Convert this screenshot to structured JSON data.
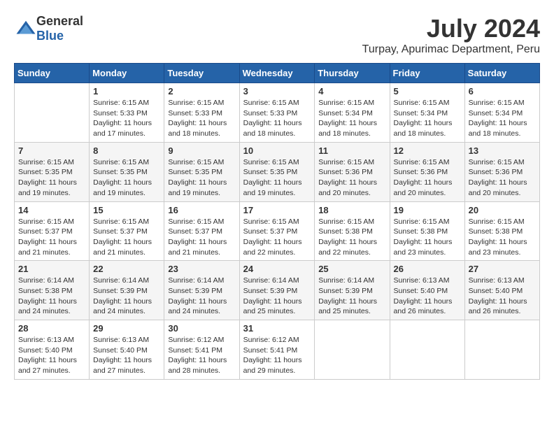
{
  "header": {
    "logo_general": "General",
    "logo_blue": "Blue",
    "month_title": "July 2024",
    "location": "Turpay, Apurimac Department, Peru"
  },
  "weekdays": [
    "Sunday",
    "Monday",
    "Tuesday",
    "Wednesday",
    "Thursday",
    "Friday",
    "Saturday"
  ],
  "weeks": [
    [
      {
        "day": "",
        "sunrise": "",
        "sunset": "",
        "daylight": ""
      },
      {
        "day": "1",
        "sunrise": "Sunrise: 6:15 AM",
        "sunset": "Sunset: 5:33 PM",
        "daylight": "Daylight: 11 hours and 17 minutes."
      },
      {
        "day": "2",
        "sunrise": "Sunrise: 6:15 AM",
        "sunset": "Sunset: 5:33 PM",
        "daylight": "Daylight: 11 hours and 18 minutes."
      },
      {
        "day": "3",
        "sunrise": "Sunrise: 6:15 AM",
        "sunset": "Sunset: 5:33 PM",
        "daylight": "Daylight: 11 hours and 18 minutes."
      },
      {
        "day": "4",
        "sunrise": "Sunrise: 6:15 AM",
        "sunset": "Sunset: 5:34 PM",
        "daylight": "Daylight: 11 hours and 18 minutes."
      },
      {
        "day": "5",
        "sunrise": "Sunrise: 6:15 AM",
        "sunset": "Sunset: 5:34 PM",
        "daylight": "Daylight: 11 hours and 18 minutes."
      },
      {
        "day": "6",
        "sunrise": "Sunrise: 6:15 AM",
        "sunset": "Sunset: 5:34 PM",
        "daylight": "Daylight: 11 hours and 18 minutes."
      }
    ],
    [
      {
        "day": "7",
        "sunrise": "Sunrise: 6:15 AM",
        "sunset": "Sunset: 5:35 PM",
        "daylight": "Daylight: 11 hours and 19 minutes."
      },
      {
        "day": "8",
        "sunrise": "Sunrise: 6:15 AM",
        "sunset": "Sunset: 5:35 PM",
        "daylight": "Daylight: 11 hours and 19 minutes."
      },
      {
        "day": "9",
        "sunrise": "Sunrise: 6:15 AM",
        "sunset": "Sunset: 5:35 PM",
        "daylight": "Daylight: 11 hours and 19 minutes."
      },
      {
        "day": "10",
        "sunrise": "Sunrise: 6:15 AM",
        "sunset": "Sunset: 5:35 PM",
        "daylight": "Daylight: 11 hours and 19 minutes."
      },
      {
        "day": "11",
        "sunrise": "Sunrise: 6:15 AM",
        "sunset": "Sunset: 5:36 PM",
        "daylight": "Daylight: 11 hours and 20 minutes."
      },
      {
        "day": "12",
        "sunrise": "Sunrise: 6:15 AM",
        "sunset": "Sunset: 5:36 PM",
        "daylight": "Daylight: 11 hours and 20 minutes."
      },
      {
        "day": "13",
        "sunrise": "Sunrise: 6:15 AM",
        "sunset": "Sunset: 5:36 PM",
        "daylight": "Daylight: 11 hours and 20 minutes."
      }
    ],
    [
      {
        "day": "14",
        "sunrise": "Sunrise: 6:15 AM",
        "sunset": "Sunset: 5:37 PM",
        "daylight": "Daylight: 11 hours and 21 minutes."
      },
      {
        "day": "15",
        "sunrise": "Sunrise: 6:15 AM",
        "sunset": "Sunset: 5:37 PM",
        "daylight": "Daylight: 11 hours and 21 minutes."
      },
      {
        "day": "16",
        "sunrise": "Sunrise: 6:15 AM",
        "sunset": "Sunset: 5:37 PM",
        "daylight": "Daylight: 11 hours and 21 minutes."
      },
      {
        "day": "17",
        "sunrise": "Sunrise: 6:15 AM",
        "sunset": "Sunset: 5:37 PM",
        "daylight": "Daylight: 11 hours and 22 minutes."
      },
      {
        "day": "18",
        "sunrise": "Sunrise: 6:15 AM",
        "sunset": "Sunset: 5:38 PM",
        "daylight": "Daylight: 11 hours and 22 minutes."
      },
      {
        "day": "19",
        "sunrise": "Sunrise: 6:15 AM",
        "sunset": "Sunset: 5:38 PM",
        "daylight": "Daylight: 11 hours and 23 minutes."
      },
      {
        "day": "20",
        "sunrise": "Sunrise: 6:15 AM",
        "sunset": "Sunset: 5:38 PM",
        "daylight": "Daylight: 11 hours and 23 minutes."
      }
    ],
    [
      {
        "day": "21",
        "sunrise": "Sunrise: 6:14 AM",
        "sunset": "Sunset: 5:38 PM",
        "daylight": "Daylight: 11 hours and 24 minutes."
      },
      {
        "day": "22",
        "sunrise": "Sunrise: 6:14 AM",
        "sunset": "Sunset: 5:39 PM",
        "daylight": "Daylight: 11 hours and 24 minutes."
      },
      {
        "day": "23",
        "sunrise": "Sunrise: 6:14 AM",
        "sunset": "Sunset: 5:39 PM",
        "daylight": "Daylight: 11 hours and 24 minutes."
      },
      {
        "day": "24",
        "sunrise": "Sunrise: 6:14 AM",
        "sunset": "Sunset: 5:39 PM",
        "daylight": "Daylight: 11 hours and 25 minutes."
      },
      {
        "day": "25",
        "sunrise": "Sunrise: 6:14 AM",
        "sunset": "Sunset: 5:39 PM",
        "daylight": "Daylight: 11 hours and 25 minutes."
      },
      {
        "day": "26",
        "sunrise": "Sunrise: 6:13 AM",
        "sunset": "Sunset: 5:40 PM",
        "daylight": "Daylight: 11 hours and 26 minutes."
      },
      {
        "day": "27",
        "sunrise": "Sunrise: 6:13 AM",
        "sunset": "Sunset: 5:40 PM",
        "daylight": "Daylight: 11 hours and 26 minutes."
      }
    ],
    [
      {
        "day": "28",
        "sunrise": "Sunrise: 6:13 AM",
        "sunset": "Sunset: 5:40 PM",
        "daylight": "Daylight: 11 hours and 27 minutes."
      },
      {
        "day": "29",
        "sunrise": "Sunrise: 6:13 AM",
        "sunset": "Sunset: 5:40 PM",
        "daylight": "Daylight: 11 hours and 27 minutes."
      },
      {
        "day": "30",
        "sunrise": "Sunrise: 6:12 AM",
        "sunset": "Sunset: 5:41 PM",
        "daylight": "Daylight: 11 hours and 28 minutes."
      },
      {
        "day": "31",
        "sunrise": "Sunrise: 6:12 AM",
        "sunset": "Sunset: 5:41 PM",
        "daylight": "Daylight: 11 hours and 29 minutes."
      },
      {
        "day": "",
        "sunrise": "",
        "sunset": "",
        "daylight": ""
      },
      {
        "day": "",
        "sunrise": "",
        "sunset": "",
        "daylight": ""
      },
      {
        "day": "",
        "sunrise": "",
        "sunset": "",
        "daylight": ""
      }
    ]
  ]
}
